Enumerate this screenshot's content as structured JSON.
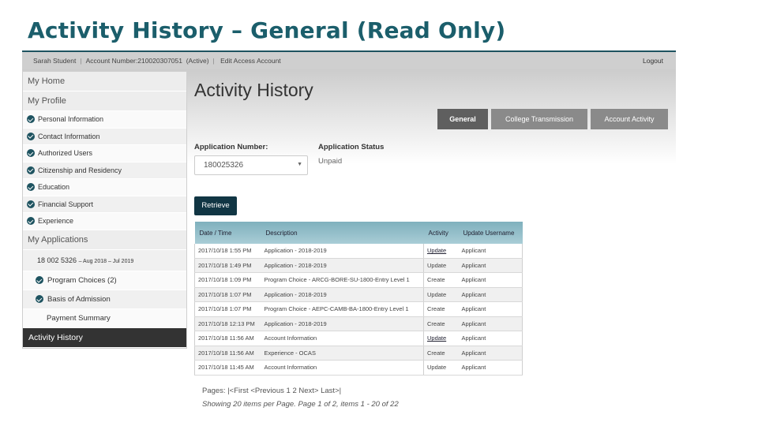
{
  "slide_title": "Activity History – General (Read Only)",
  "topbar": {
    "user_name": "Sarah Student",
    "account_number": "Account Number:210020307051",
    "account_status": "(Active)",
    "edit_link": "Edit Access Account",
    "logout": "Logout"
  },
  "sidebar": {
    "my_home": "My Home",
    "my_profile": "My Profile",
    "profile_items": [
      {
        "label": "Personal Information",
        "icon": "check-circle-icon"
      },
      {
        "label": "Contact Information",
        "icon": "check-circle-icon"
      },
      {
        "label": "Authorized Users",
        "icon": "check-circle-icon"
      },
      {
        "label": "Citizenship and Residency",
        "icon": "check-circle-icon"
      },
      {
        "label": "Education",
        "icon": "check-circle-icon"
      },
      {
        "label": "Financial Support",
        "icon": "check-circle-icon"
      },
      {
        "label": "Experience",
        "icon": "check-circle-icon"
      }
    ],
    "my_applications": "My Applications",
    "application_number": "18 002 5326",
    "application_term": "– Aug 2018 – Jul 2019",
    "application_items": [
      {
        "label": "Program Choices (2)",
        "icon": "check-circle-icon"
      },
      {
        "label": "Basis of Admission",
        "icon": "check-circle-icon"
      }
    ],
    "payment_summary": "Payment Summary",
    "activity_history": "Activity History"
  },
  "main": {
    "title": "Activity History",
    "tabs": [
      {
        "label": "General",
        "active": true
      },
      {
        "label": "College Transmission",
        "active": false
      },
      {
        "label": "Account Activity",
        "active": false
      }
    ],
    "application_number_label": "Application Number:",
    "application_number_value": "180025326",
    "application_status_label": "Application Status",
    "application_status_value": "Unpaid",
    "retrieve_button": "Retrieve",
    "table": {
      "headers": [
        "Date / Time",
        "Description",
        "Activity",
        "Update Username"
      ],
      "rows": [
        {
          "date": "2017/10/18 1:55 PM",
          "description": "Application - 2018-2019",
          "activity": "Update",
          "activity_link": true,
          "username": "Applicant"
        },
        {
          "date": "2017/10/18 1:49 PM",
          "description": "Application - 2018-2019",
          "activity": "Update",
          "activity_link": false,
          "username": "Applicant"
        },
        {
          "date": "2017/10/18 1:09 PM",
          "description": "Program Choice - ARCG-BORE-SU-1800-Entry Level 1",
          "activity": "Create",
          "activity_link": false,
          "username": "Applicant"
        },
        {
          "date": "2017/10/18 1:07 PM",
          "description": "Application - 2018-2019",
          "activity": "Update",
          "activity_link": false,
          "username": "Applicant"
        },
        {
          "date": "2017/10/18 1:07 PM",
          "description": "Program Choice - AEPC-CAMB-BA-1800-Entry Level 1",
          "activity": "Create",
          "activity_link": false,
          "username": "Applicant"
        },
        {
          "date": "2017/10/18 12:13 PM",
          "description": "Application - 2018-2019",
          "activity": "Create",
          "activity_link": false,
          "username": "Applicant"
        },
        {
          "date": "2017/10/18 11:56 AM",
          "description": "Account Information",
          "activity": "Update",
          "activity_link": true,
          "username": "Applicant"
        },
        {
          "date": "2017/10/18 11:56 AM",
          "description": "Experience - OCAS",
          "activity": "Create",
          "activity_link": false,
          "username": "Applicant"
        },
        {
          "date": "2017/10/18 11:45 AM",
          "description": "Account Information",
          "activity": "Update",
          "activity_link": false,
          "username": "Applicant"
        }
      ]
    },
    "pager": {
      "prefix": "Pages:",
      "first": "|<First",
      "previous": "<Previous",
      "pages": [
        "1",
        "2"
      ],
      "next": "Next>",
      "last": "Last>|"
    },
    "showing_text": "Showing 20 items per Page. Page 1 of 2, items 1 - 20 of 22"
  },
  "colors": {
    "title_teal": "#1b5e6b",
    "nav_dark": "#333333",
    "check_icon": "#1e5360",
    "retrieve_button": "#113644",
    "tab_active": "#5f5f5f",
    "tab_inactive": "#8a8a8a",
    "table_header": "#95c0cb"
  }
}
